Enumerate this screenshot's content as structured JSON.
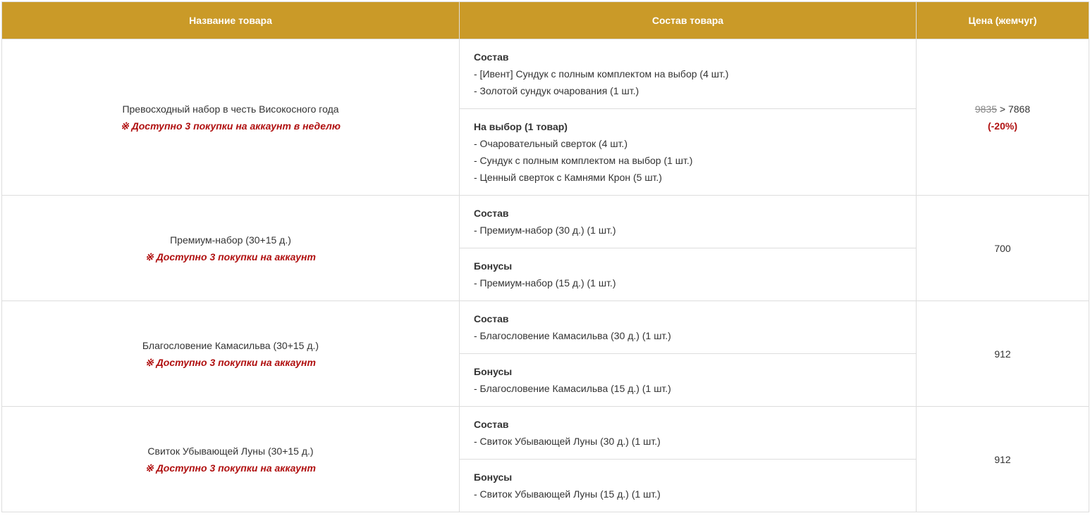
{
  "header": {
    "name": "Название товара",
    "composition": "Состав товара",
    "price": "Цена (жемчуг)"
  },
  "rows": [
    {
      "name": "Превосходный набор в честь Високосного года",
      "note": "※ Доступно 3 покупки на аккаунт в неделю",
      "blocks": [
        {
          "title": "Состав",
          "items": [
            "- [Ивент] Сундук с полным комплектом на выбор (4 шт.)",
            "- Золотой сундук очарования (1 шт.)"
          ]
        },
        {
          "title": "На выбор (1 товар)",
          "items": [
            "- Очаровательный сверток (4 шт.)",
            "- Сундук с полным комплектом на выбор (1 шт.)",
            "- Ценный сверток с Камнями Крон (5 шт.)"
          ]
        }
      ],
      "price_old": "9835",
      "price_sep": " > ",
      "price": "7868",
      "discount": "(-20%)"
    },
    {
      "name": "Премиум-набор (30+15 д.)",
      "note": "※ Доступно 3 покупки на аккаунт",
      "blocks": [
        {
          "title": "Состав",
          "items": [
            "- Премиум-набор (30 д.) (1 шт.)"
          ]
        },
        {
          "title": "Бонусы",
          "items": [
            "- Премиум-набор (15 д.) (1 шт.)"
          ]
        }
      ],
      "price": "700"
    },
    {
      "name": "Благословение Камасильва (30+15 д.)",
      "note": "※ Доступно 3 покупки на аккаунт",
      "blocks": [
        {
          "title": "Состав",
          "items": [
            "- Благословение Камасильва (30 д.) (1 шт.)"
          ]
        },
        {
          "title": "Бонусы",
          "items": [
            "- Благословение Камасильва (15 д.) (1 шт.)"
          ]
        }
      ],
      "price": "912"
    },
    {
      "name": "Свиток Убывающей Луны (30+15 д.)",
      "note": "※ Доступно 3 покупки на аккаунт",
      "blocks": [
        {
          "title": "Состав",
          "items": [
            "- Свиток Убывающей Луны (30 д.) (1 шт.)"
          ]
        },
        {
          "title": "Бонусы",
          "items": [
            "- Свиток Убывающей Луны (15 д.) (1 шт.)"
          ]
        }
      ],
      "price": "912"
    }
  ]
}
